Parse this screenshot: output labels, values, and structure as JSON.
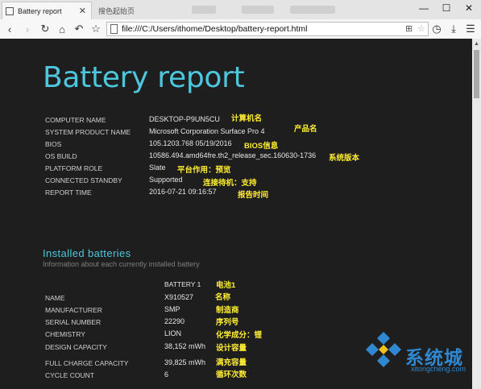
{
  "browser": {
    "active_tab_title": "Battery report",
    "inactive_tab_title": "搜色起始页",
    "url": "file:///C:/Users/ithome/Desktop/battery-report.html"
  },
  "report": {
    "title": "Battery report",
    "info": [
      {
        "label": "COMPUTER NAME",
        "value": "DESKTOP-P9UN5CU"
      },
      {
        "label": "SYSTEM PRODUCT NAME",
        "value": "Microsoft Corporation Surface Pro 4"
      },
      {
        "label": "BIOS",
        "value": "105.1203.768 05/19/2016"
      },
      {
        "label": "OS BUILD",
        "value": "10586.494.amd64fre.th2_release_sec.160630-1736"
      },
      {
        "label": "PLATFORM ROLE",
        "value": "Slate"
      },
      {
        "label": "CONNECTED STANDBY",
        "value": "Supported"
      },
      {
        "label": "REPORT TIME",
        "value": "2016-07-21 09:16:57"
      }
    ],
    "info_notes": [
      "计算机名",
      "产品名",
      "BIOS信息",
      "系统版本",
      "平台作用：预览",
      "连接待机：支持",
      "报告时间"
    ],
    "installed": {
      "heading": "Installed batteries",
      "subtitle": "Information about each currently installed battery",
      "column": "BATTERY 1",
      "column_note": "电池1",
      "rows": [
        {
          "label": "NAME",
          "value": "X910527",
          "note": "名称"
        },
        {
          "label": "MANUFACTURER",
          "value": "SMP",
          "note": "制造商"
        },
        {
          "label": "SERIAL NUMBER",
          "value": "22290",
          "note": "序列号"
        },
        {
          "label": "CHEMISTRY",
          "value": "LION",
          "note": "化学成分：锂"
        },
        {
          "label": "DESIGN CAPACITY",
          "value": "38,152 mWh",
          "note": "设计容量"
        },
        {
          "label": "FULL CHARGE CAPACITY",
          "value": "39,825 mWh",
          "note": "满充容量"
        },
        {
          "label": "CYCLE COUNT",
          "value": "6",
          "note": "循环次数"
        }
      ]
    }
  },
  "watermark": {
    "name": "系统城",
    "url": "xitongcheng.com"
  },
  "colors": {
    "accent": "#4dc7de",
    "annotation": "#ffee33",
    "watermark": "#2f88d0",
    "background": "#1e1e1e"
  },
  "icons": [
    "page-icon",
    "close-icon",
    "minimize-icon",
    "maximize-icon",
    "back-icon",
    "forward-icon",
    "reload-icon",
    "home-icon",
    "undo-icon",
    "star-icon",
    "file-icon",
    "translate-icon",
    "history-icon",
    "download-icon",
    "menu-icon"
  ]
}
